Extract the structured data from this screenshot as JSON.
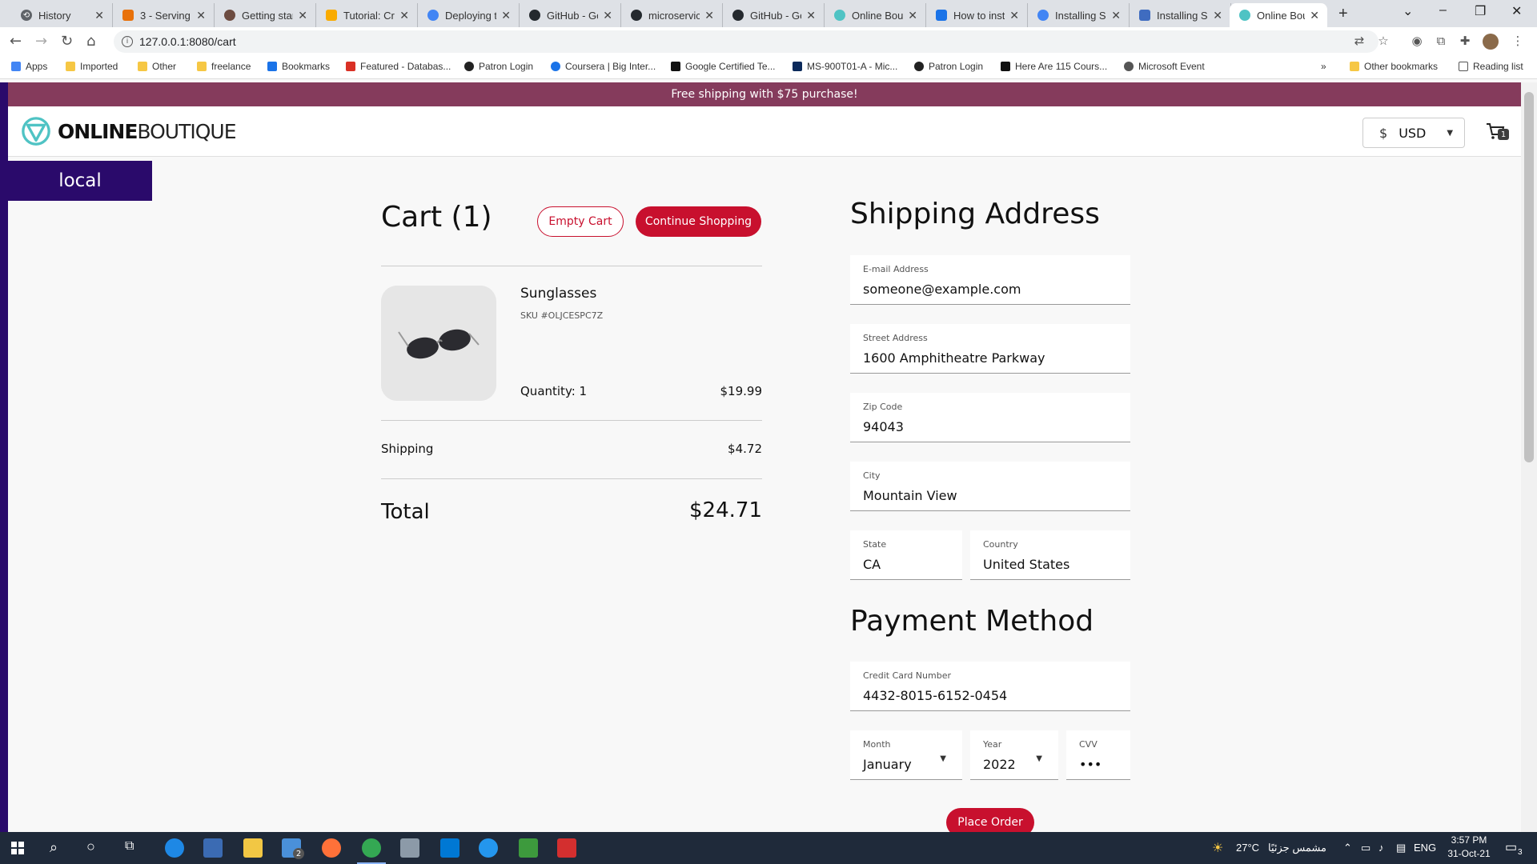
{
  "browser": {
    "tabs": [
      {
        "label": "History",
        "icon": "history-icon",
        "color": "#5f6368"
      },
      {
        "label": "3 - Serving",
        "icon": "tab-favicon-icon",
        "color": "#e8710a"
      },
      {
        "label": "Getting star",
        "icon": "tab-favicon-icon",
        "color": "#6d4c41"
      },
      {
        "label": "Tutorial: Cre",
        "icon": "tab-favicon-icon",
        "color": "#f9ab00"
      },
      {
        "label": "Deploying t",
        "icon": "google-cloud-icon",
        "color": "#4285f4"
      },
      {
        "label": "GitHub - Go",
        "icon": "github-icon",
        "color": "#24292e"
      },
      {
        "label": "microservic",
        "icon": "github-icon",
        "color": "#24292e"
      },
      {
        "label": "GitHub - Go",
        "icon": "github-icon",
        "color": "#24292e"
      },
      {
        "label": "Online Bout",
        "icon": "online-boutique-icon",
        "color": "#4fc3c4"
      },
      {
        "label": "How to inst",
        "icon": "tab-favicon-icon",
        "color": "#1a73e8"
      },
      {
        "label": "Installing Sk",
        "icon": "google-icon",
        "color": "#4285f4"
      },
      {
        "label": "Installing Sk",
        "icon": "tab-favicon-icon",
        "color": "#3f6cc0"
      },
      {
        "label": "Online Bout",
        "icon": "online-boutique-icon",
        "color": "#4fc3c4"
      }
    ],
    "url": "127.0.0.1:8080/cart",
    "bookmarks": [
      {
        "label": "Apps",
        "color": "#4285f4"
      },
      {
        "label": "Imported",
        "color": "#f6c744"
      },
      {
        "label": "Other",
        "color": "#f6c744"
      },
      {
        "label": "freelance",
        "color": "#f6c744"
      },
      {
        "label": "Bookmarks",
        "color": "#1a73e8"
      },
      {
        "label": "Featured - Databas...",
        "color": "#d93025"
      },
      {
        "label": "Patron Login",
        "color": "#222222"
      },
      {
        "label": "Coursera | Big Inter...",
        "color": "#1a73e8"
      },
      {
        "label": "Google Certified Te...",
        "color": "#111111"
      },
      {
        "label": "MS-900T01-A - Mic...",
        "color": "#0b2a5b"
      },
      {
        "label": "Patron Login",
        "color": "#222222"
      },
      {
        "label": "Here Are 115 Cours...",
        "color": "#111111"
      },
      {
        "label": "Microsoft Event",
        "color": "#555555"
      }
    ],
    "other_bookmarks": "Other bookmarks",
    "reading_list": "Reading list"
  },
  "site": {
    "banner": "Free shipping with $75 purchase!",
    "logo_bold": "ONLINE",
    "logo_light": "BOUTIQUE",
    "currency_symbol": "$",
    "currency_code": "USD",
    "cart_count": "1",
    "cluster_label": "local",
    "accent": "#c8102e",
    "banner_color": "#853b5c",
    "cluster_color": "#2a0a6b"
  },
  "cart": {
    "title": "Cart (1)",
    "empty_label": "Empty Cart",
    "continue_label": "Continue Shopping",
    "item": {
      "name": "Sunglasses",
      "sku": "SKU #OLJCESPC7Z",
      "quantity": "Quantity: 1",
      "price": "$19.99"
    },
    "shipping_label": "Shipping",
    "shipping_value": "$4.72",
    "total_label": "Total",
    "total_value": "$24.71"
  },
  "shipping": {
    "title": "Shipping Address",
    "email": {
      "label": "E-mail Address",
      "value": "someone@example.com"
    },
    "street": {
      "label": "Street Address",
      "value": "1600 Amphitheatre Parkway"
    },
    "zip": {
      "label": "Zip Code",
      "value": "94043"
    },
    "city": {
      "label": "City",
      "value": "Mountain View"
    },
    "state": {
      "label": "State",
      "value": "CA"
    },
    "country": {
      "label": "Country",
      "value": "United States"
    }
  },
  "payment": {
    "title": "Payment Method",
    "card": {
      "label": "Credit Card Number",
      "value": "4432-8015-6152-0454"
    },
    "month": {
      "label": "Month",
      "value": "January"
    },
    "year": {
      "label": "Year",
      "value": "2022"
    },
    "cvv": {
      "label": "CVV",
      "value": "•••"
    },
    "place_order": "Place Order"
  },
  "taskbar": {
    "weather": "27°C",
    "weather_text": "مشمس جزئيًا",
    "lang": "ENG",
    "time": "3:57 PM",
    "date": "31-Oct-21",
    "notifications": "3",
    "mail_badge": "2"
  }
}
